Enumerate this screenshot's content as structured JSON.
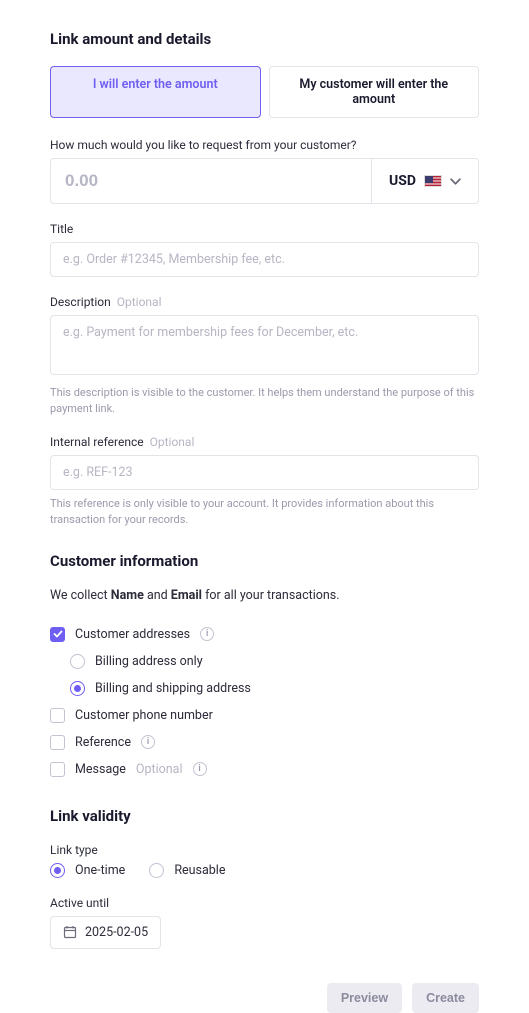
{
  "section1": {
    "title": "Link amount and details",
    "tabs": {
      "enter": "I will enter the amount",
      "customer": "My customer will enter the amount"
    },
    "amount": {
      "label": "How much would you like to request from your customer?",
      "placeholder": "0.00",
      "currency": "USD"
    },
    "titleField": {
      "label": "Title",
      "placeholder": "e.g. Order #12345, Membership fee, etc."
    },
    "description": {
      "label": "Description",
      "optional": "Optional",
      "placeholder": "e.g. Payment for membership fees for December, etc.",
      "helper": "This description is visible to the customer. It helps them understand the purpose of this payment link."
    },
    "internalRef": {
      "label": "Internal reference",
      "optional": "Optional",
      "placeholder": "e.g. REF-123",
      "helper": "This reference is only visible to your account. It provides information about this transaction for your records."
    }
  },
  "section2": {
    "title": "Customer information",
    "collect_prefix": "We collect ",
    "collect_name": "Name",
    "collect_and": " and ",
    "collect_email": "Email",
    "collect_suffix": " for all your transactions.",
    "addresses": {
      "label": "Customer addresses",
      "billing_only": "Billing address only",
      "billing_shipping": "Billing and shipping address"
    },
    "phone": "Customer phone number",
    "reference": "Reference",
    "message": {
      "label": "Message",
      "optional": "Optional"
    }
  },
  "section3": {
    "title": "Link validity",
    "linkType": {
      "label": "Link type",
      "onetime": "One-time",
      "reusable": "Reusable"
    },
    "activeUntil": {
      "label": "Active until",
      "value": "2025-02-05"
    }
  },
  "footer": {
    "preview": "Preview",
    "create": "Create"
  }
}
